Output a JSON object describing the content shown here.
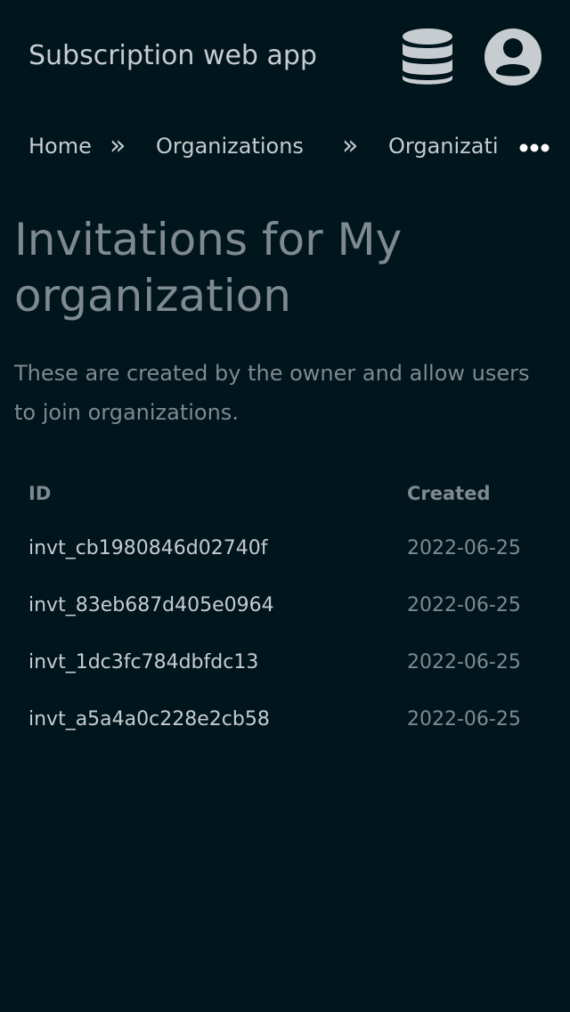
{
  "header": {
    "app_title": "Subscription web app",
    "database_icon": "database-icon",
    "account_icon": "user-circle-icon"
  },
  "breadcrumb": {
    "items": [
      {
        "label": "Home"
      },
      {
        "label": "Organizations"
      },
      {
        "label": "Organizati"
      }
    ],
    "separator": "»",
    "more_icon": "ellipsis-icon"
  },
  "page": {
    "title": "Invitations for My organization",
    "description": "These are created by the owner and allow users to join organizations."
  },
  "table": {
    "columns": {
      "id": "ID",
      "created": "Created"
    },
    "rows": [
      {
        "id": "invt_cb1980846d02740f",
        "created": "2022-06-25"
      },
      {
        "id": "invt_83eb687d405e0964",
        "created": "2022-06-25"
      },
      {
        "id": "invt_1dc3fc784dbfdc13",
        "created": "2022-06-25"
      },
      {
        "id": "invt_a5a4a0c228e2cb58",
        "created": "2022-06-25"
      }
    ]
  },
  "colors": {
    "background": "#00151c",
    "text_primary": "#c6cccf",
    "text_muted": "#7f8a8f"
  }
}
